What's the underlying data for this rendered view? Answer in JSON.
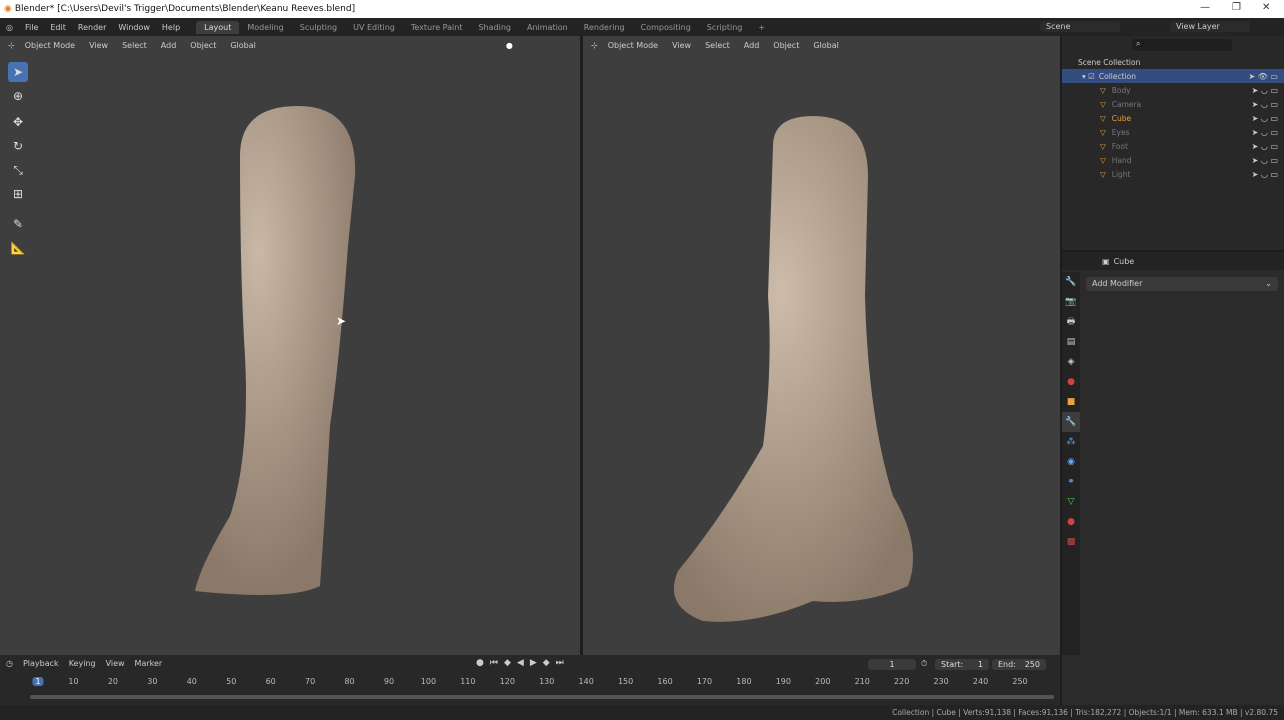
{
  "title": "Blender* [C:\\Users\\Devil's Trigger\\Documents\\Blender\\Keanu Reeves.blend]",
  "menu": [
    "File",
    "Edit",
    "Render",
    "Window",
    "Help"
  ],
  "workspaces": [
    "Layout",
    "Modeling",
    "Sculpting",
    "UV Editing",
    "Texture Paint",
    "Shading",
    "Animation",
    "Rendering",
    "Compositing",
    "Scripting",
    "+"
  ],
  "scene": "Scene",
  "view_layer": "View Layer",
  "viewport": {
    "mode": "Object Mode",
    "menus": [
      "View",
      "Select",
      "Add",
      "Object"
    ],
    "orientation": "Global"
  },
  "outliner": {
    "root": "Scene Collection",
    "collection": "Collection",
    "items": [
      {
        "name": "Body",
        "active": false
      },
      {
        "name": "Camera",
        "active": false
      },
      {
        "name": "Cube",
        "active": true
      },
      {
        "name": "Eyes",
        "active": false
      },
      {
        "name": "Foot",
        "active": false
      },
      {
        "name": "Hand",
        "active": false
      },
      {
        "name": "Light",
        "active": false
      }
    ]
  },
  "properties": {
    "object": "Cube",
    "add_modifier": "Add Modifier"
  },
  "timeline": {
    "menus": [
      "Playback",
      "Keying",
      "View",
      "Marker"
    ],
    "current_frame": "1",
    "start_label": "Start:",
    "start": "1",
    "end_label": "End:",
    "end": "250",
    "ticks": [
      "1",
      "10",
      "20",
      "30",
      "40",
      "50",
      "60",
      "70",
      "80",
      "90",
      "100",
      "110",
      "120",
      "130",
      "140",
      "150",
      "160",
      "170",
      "180",
      "190",
      "200",
      "210",
      "220",
      "230",
      "240",
      "250"
    ]
  },
  "status": "Collection | Cube | Verts:91,138 | Faces:91,136 | Tris:182,272 | Objects:1/1 | Mem: 633.1 MB | v2.80.75",
  "colors": {
    "accent": "#4772b3",
    "selected_row": "#334d80",
    "active_object": "#e8a040"
  }
}
